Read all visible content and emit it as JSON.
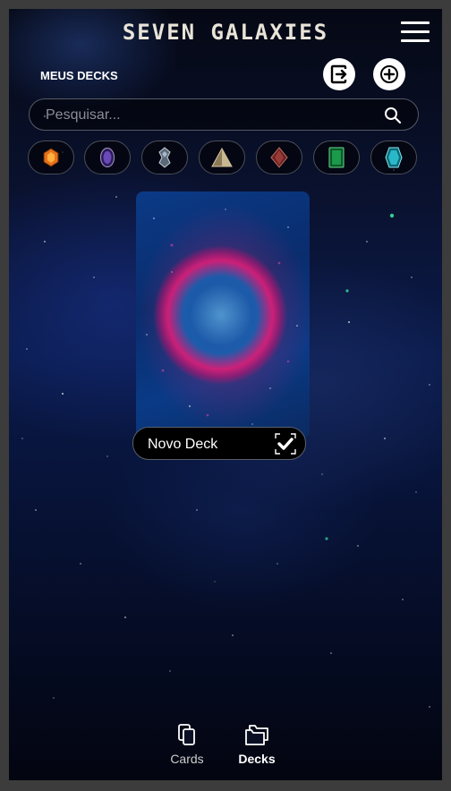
{
  "header": {
    "title": "SEVEN GALAXIES"
  },
  "section": {
    "title": "MEUS DECKS"
  },
  "search": {
    "placeholder": "Pesquisar..."
  },
  "filters": [
    {
      "name": "orange-gem",
      "color": "#e8701a"
    },
    {
      "name": "purple-oval-gem",
      "color": "#5a3a9a"
    },
    {
      "name": "silver-crystal",
      "color": "#8898a8"
    },
    {
      "name": "tan-pyramid",
      "color": "#b8a47a"
    },
    {
      "name": "red-diamond",
      "color": "#9a3a38"
    },
    {
      "name": "green-emerald",
      "color": "#1a9a4a"
    },
    {
      "name": "cyan-crystal",
      "color": "#2ab8c8"
    }
  ],
  "deck": {
    "name_value": "Novo Deck"
  },
  "nav": {
    "cards_label": "Cards",
    "decks_label": "Decks"
  }
}
